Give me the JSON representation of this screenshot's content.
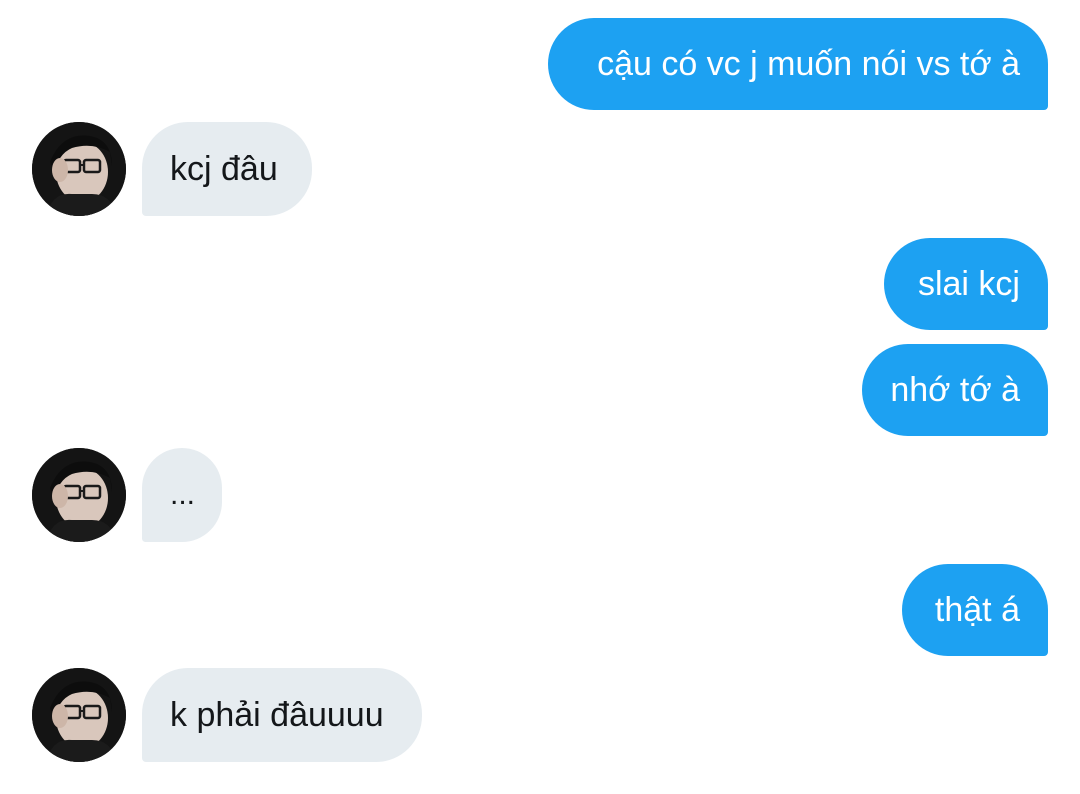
{
  "conversation": {
    "messages": [
      {
        "sender": "me",
        "text": "cậu có vc j muốn nói vs tớ à"
      },
      {
        "sender": "them",
        "text": "kcj đâu"
      },
      {
        "sender": "me",
        "text": "slai kcj"
      },
      {
        "sender": "me",
        "text": "nhớ tớ à"
      },
      {
        "sender": "them",
        "text": "..."
      },
      {
        "sender": "me",
        "text": "thật á"
      },
      {
        "sender": "them",
        "text": "k phải đâuuuu"
      }
    ]
  },
  "colors": {
    "outgoing_bubble": "#1da1f2",
    "incoming_bubble": "#e6ecf0",
    "background": "#ffffff"
  },
  "icons": {
    "avatar": "contact-avatar-photo"
  }
}
